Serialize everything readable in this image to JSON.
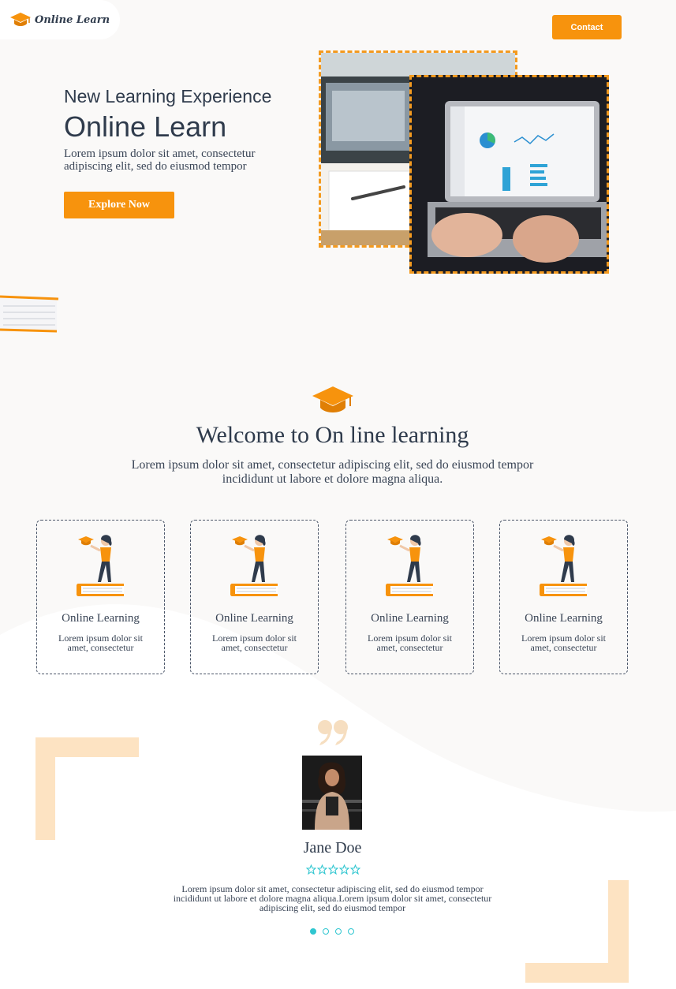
{
  "brand": {
    "name": "Online Learn",
    "icon": "graduation-cap-icon"
  },
  "header": {
    "contact_label": "Contact"
  },
  "hero": {
    "subtitle": "New Learning Experience",
    "title": "Online Learn",
    "description": "Lorem ipsum dolor sit amet, consectetur adipiscing elit, sed do eiusmod tempor",
    "cta_label": "Explore Now"
  },
  "welcome": {
    "icon": "graduation-cap-icon",
    "title": "Welcome to On line learning",
    "description": "Lorem ipsum dolor sit amet, consectetur adipiscing elit, sed do eiusmod tempor incididunt ut labore et dolore magna aliqua."
  },
  "features": [
    {
      "title": "Online Learning",
      "text": "Lorem ipsum dolor sit amet, consectetur"
    },
    {
      "title": "Online Learning",
      "text": "Lorem ipsum dolor sit amet, consectetur"
    },
    {
      "title": "Online Learning",
      "text": "Lorem ipsum dolor sit amet, consectetur"
    },
    {
      "title": "Online Learning",
      "text": "Lorem ipsum dolor sit amet, consectetur"
    }
  ],
  "testimonial": {
    "quote_icon": "quote-icon",
    "name": "Jane Doe",
    "rating": 5,
    "text": "Lorem ipsum dolor sit amet, consectetur adipiscing elit, sed do eiusmod tempor incididunt ut labore et dolore magna aliqua.Lorem ipsum dolor sit amet, consectetur adipiscing elit, sed do eiusmod tempor",
    "slides": 4,
    "active_slide": 1
  },
  "colors": {
    "accent": "#f7930d",
    "text": "#2f3b4c",
    "background": "#faf9f8",
    "teal": "#2fc6d0",
    "corner_deco": "#fde3c2"
  }
}
